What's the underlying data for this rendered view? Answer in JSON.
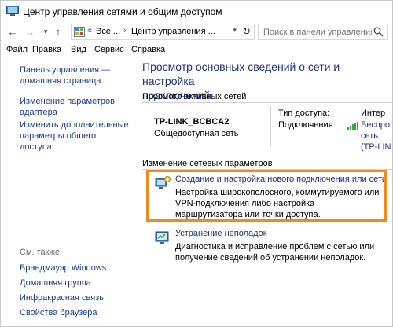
{
  "window": {
    "title": "Центр управления сетями и общим доступом"
  },
  "nav": {
    "breadcrumb_root": "Все ...",
    "breadcrumb_current": "Центр управления ...",
    "search_placeholder": "Поиск в панели управления"
  },
  "menu": {
    "items": [
      {
        "label": "Файл"
      },
      {
        "label": "Правка"
      },
      {
        "label": "Вид"
      },
      {
        "label": "Сервис"
      },
      {
        "label": "Справка"
      }
    ]
  },
  "left": {
    "home_line1": "Панель управления —",
    "home_line2": "домашняя страница",
    "adapter_line1": "Изменение параметров",
    "adapter_line2": "адаптера",
    "sharing_line1": "Изменить дополнительные",
    "sharing_line2": "параметры общего доступа",
    "see_also": "См. также",
    "see_also_items": [
      {
        "label": "Брандмауэр Windows"
      },
      {
        "label": "Домашняя группа"
      },
      {
        "label": "Инфракрасная связь"
      },
      {
        "label": "Свойства браузера"
      }
    ]
  },
  "main": {
    "title_line1": "Просмотр основных сведений о сети и настройка",
    "title_line2": "подключений",
    "active_networks_header": "Просмотр активных сетей",
    "network": {
      "name": "TP-LINK_BCBCA2",
      "type": "Общедоступная сеть",
      "access_label": "Тип доступа:",
      "access_value": "Интер",
      "connections_label": "Подключения:",
      "connections_value_1": "Беспро",
      "connections_value_2": "сеть",
      "connections_value_3": "(TP-LIN"
    },
    "change_settings_header": "Изменение сетевых параметров",
    "tasks": [
      {
        "link": "Создание и настройка нового подключения или сети",
        "desc": "Настройка широкополосного, коммутируемого или VPN-подключения либо настройка маршрутизатора или точки доступа."
      },
      {
        "link": "Устранение неполадок",
        "desc": "Диагностика и исправление проблем с сетью или получение сведений об устранении неполадок."
      }
    ]
  },
  "colors": {
    "link": "#1e3287",
    "highlight": "#ef8a1e"
  }
}
